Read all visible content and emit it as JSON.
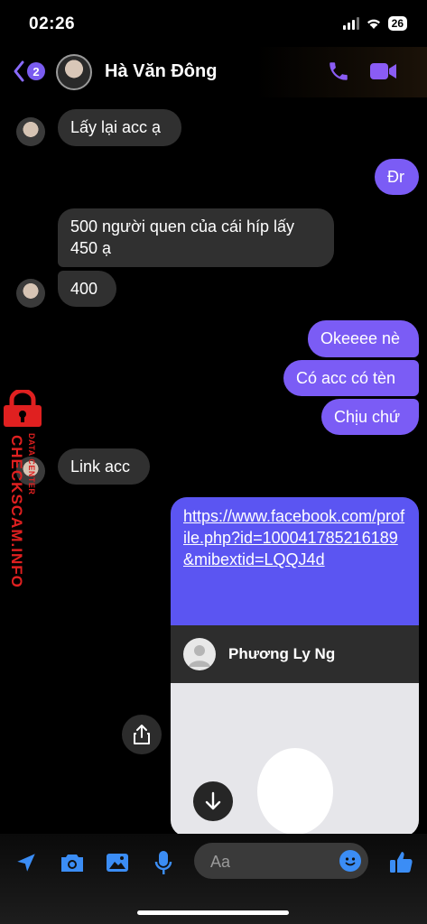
{
  "status_bar": {
    "time": "02:26",
    "battery": "26"
  },
  "header": {
    "back_badge": "2",
    "contact_name": "Hà Văn Đông"
  },
  "messages": [
    {
      "side": "in",
      "text": "Lấy lại acc ạ"
    },
    {
      "side": "out",
      "text": "Đr"
    },
    {
      "side": "in",
      "text": "500 người quen của cái híp lấy 450 ạ"
    },
    {
      "side": "in",
      "text": "400"
    },
    {
      "side": "out",
      "text": "Okeeee nè"
    },
    {
      "side": "out",
      "text": "Có acc có tèn"
    },
    {
      "side": "out",
      "text": "Chịu chứ"
    },
    {
      "side": "in",
      "text": "Link acc"
    }
  ],
  "link_message": {
    "url": "https://www.facebook.com/profile.php?id=100041785216189&mibextid=LQQJ4d",
    "profile_name": "Phương Ly Ng"
  },
  "watermark": {
    "main": "CHECKSCAM.INFO",
    "sub": "DATA CENTER"
  },
  "composer": {
    "placeholder": "Aa"
  },
  "colors": {
    "accent": "#7b5cf5",
    "incoming": "#303030",
    "link_bg": "#5b55f2",
    "watermark": "#e02020"
  }
}
